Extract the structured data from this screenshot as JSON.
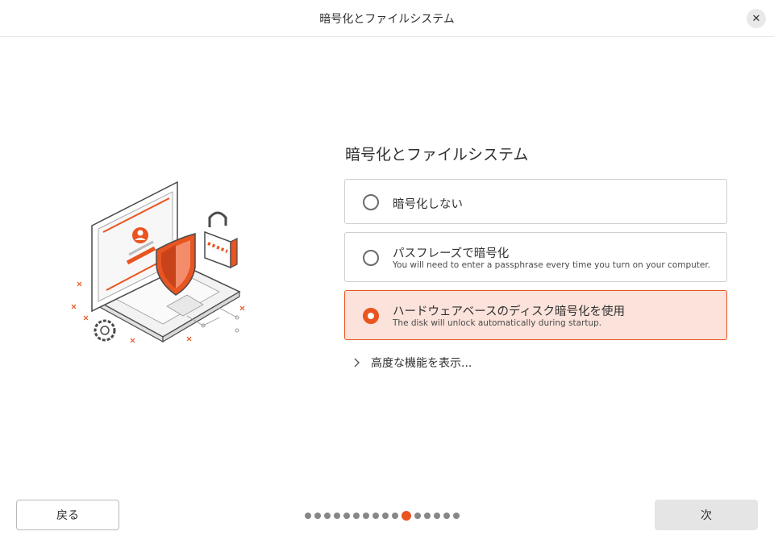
{
  "window": {
    "title": "暗号化とファイルシステム"
  },
  "heading": "暗号化とファイルシステム",
  "options": [
    {
      "label": "暗号化しない",
      "description": "",
      "selected": false
    },
    {
      "label": "パスフレーズで暗号化",
      "description": "You will need to enter a passphrase every time you turn on your computer.",
      "selected": false
    },
    {
      "label": "ハードウェアベースのディスク暗号化を使用",
      "description": "The disk will unlock automatically during startup.",
      "selected": true
    }
  ],
  "advanced": {
    "label": "高度な機能を表示..."
  },
  "footer": {
    "back_label": "戻る",
    "next_label": "次",
    "progress": {
      "total": 16,
      "current": 11
    }
  },
  "colors": {
    "accent": "#e95420",
    "selected_bg": "#fbe2da",
    "dot": "#878787"
  },
  "icons": [
    "close-icon",
    "chevron-right-icon",
    "laptop-security-illustration"
  ]
}
